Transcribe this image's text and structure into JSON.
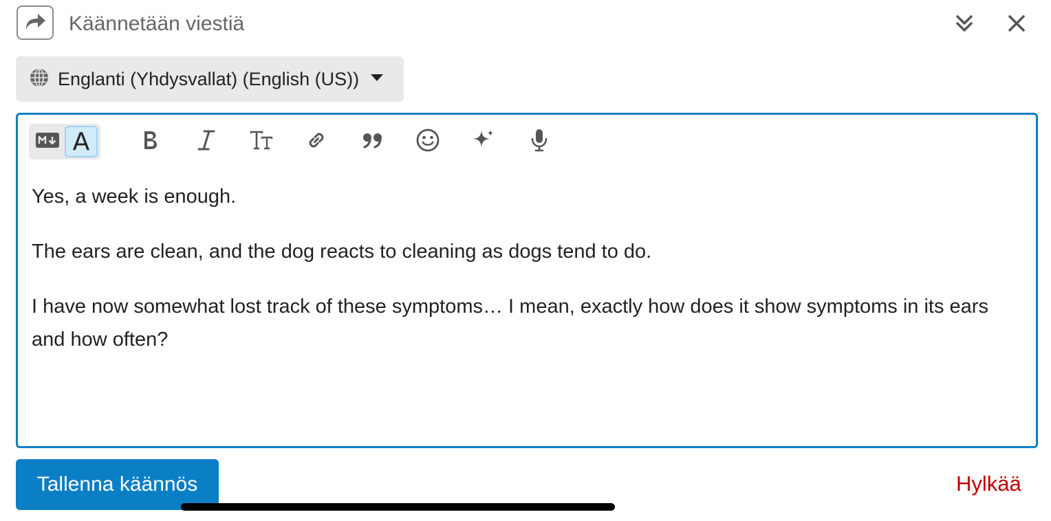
{
  "header": {
    "title": "Käännetään viestiä",
    "icons": {
      "reply": "reply-arrow-icon",
      "collapse": "double-chevron-down-icon",
      "close": "close-icon"
    }
  },
  "language_selector": {
    "value": "Englanti (Yhdysvallat) (English (US))",
    "icons": {
      "globe": "globe-icon",
      "caret": "caret-down-icon"
    }
  },
  "toolbar": {
    "markdown_toggle_icon": "markdown-icon",
    "rich_text_toggle_label": "A",
    "tools": [
      "bold-icon",
      "italic-icon",
      "text-size-icon",
      "link-icon",
      "quote-icon",
      "emoji-icon",
      "sparkle-icon",
      "microphone-icon"
    ]
  },
  "editor": {
    "paragraphs": [
      "Yes, a week is enough.",
      "The ears are clean, and the dog reacts to cleaning as dogs tend to do.",
      "I have now somewhat lost track of these symptoms… I mean, exactly how does it show symptoms in its ears and how often?"
    ]
  },
  "footer": {
    "save_label": "Tallenna käännös",
    "discard_label": "Hylkää"
  },
  "colors": {
    "accent": "#0a7fc6",
    "danger": "#c00000",
    "selector_bg": "#e9e9e9",
    "toggle_active_bg": "#d1ebfa"
  }
}
